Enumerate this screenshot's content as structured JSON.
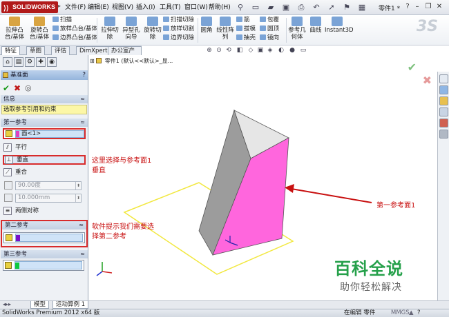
{
  "app": {
    "logo_text": "SOLIDWORKS",
    "menu": [
      "文件(F)",
      "编辑(E)",
      "视图(V)",
      "插入(I)",
      "工具(T)",
      "窗口(W)",
      "帮助(H)"
    ],
    "part_name": "零件1 *",
    "help_icon": "?"
  },
  "ribbon": {
    "big_buttons": [
      {
        "label1": "拉伸凸",
        "label2": "台/基体",
        "color": "#d9a441"
      },
      {
        "label1": "旋转凸",
        "label2": "台/基体",
        "color": "#d9a441"
      },
      {
        "label1": "拉伸切",
        "label2": "除",
        "color": "#7aa3d6"
      },
      {
        "label1": "异型孔",
        "label2": "向导",
        "color": "#7aa3d6"
      },
      {
        "label1": "旋转切",
        "label2": "除",
        "color": "#7aa3d6"
      },
      {
        "label1": "圆角",
        "label2": "",
        "color": "#7aa3d6"
      },
      {
        "label1": "线性阵",
        "label2": "列",
        "color": "#7aa3d6"
      },
      {
        "label1": "参考几",
        "label2": "何体",
        "color": "#7aa3d6"
      },
      {
        "label1": "曲线",
        "label2": "",
        "color": "#7aa3d6"
      },
      {
        "label1": "Instant3D",
        "label2": "",
        "color": "#7aa3d6"
      }
    ],
    "small_buttons": {
      "scan": "扫描",
      "loft_boss": "放样凸台/基体",
      "boundary_boss": "边界凸台/基体",
      "scan_cut": "扫描切除",
      "loft_cut": "放样切割",
      "boundary_cut": "边界切除",
      "rib": "筋",
      "draft": "拔模",
      "shell": "抽壳",
      "wrap": "包覆",
      "dome": "圆顶",
      "mirror": "镜向"
    }
  },
  "left_tabs": [
    "特征",
    "草图",
    "评估",
    "DimXpert",
    "办公室产品"
  ],
  "property_manager": {
    "title": "基准面",
    "help": "?",
    "info_header": "信息",
    "message": "选取参考引用和约束",
    "first_ref_header": "第一参考",
    "first_ref_value": "面<1>",
    "options": [
      "平行",
      "垂直",
      "重合"
    ],
    "angle_value": "90.00度",
    "distance_value": "10.000mm",
    "symmetric_label": "两侧对称",
    "second_ref_header": "第二参考",
    "third_ref_header": "第三参考",
    "first_ref_color": "#e040c0",
    "second_ref_color": "#7a10c8",
    "third_ref_color": "#10c840"
  },
  "graphics": {
    "tree_path": "零件1 (默认<<默认>_显..."
  },
  "annotations": {
    "a1_line1": "这里选择与参考面1",
    "a1_line2": "垂直",
    "a2_line1": "软件提示我们需要选",
    "a2_line2": "择第二参考",
    "a3": "第一参考面1"
  },
  "brand": {
    "title": "百科全说",
    "subtitle": "助你轻松解决"
  },
  "bottom_tabs": [
    "模型",
    "运动算例 1"
  ],
  "status": {
    "left": "SolidWorks Premium 2012 x64 版",
    "editing": "在编辑 零件",
    "units": "MMGS",
    "unit_arrow": "▲",
    "help": "?"
  },
  "colors": {
    "accent_red": "#d82b2b",
    "annotation_red": "#c81010",
    "face_magenta": "#ff66dd",
    "face_gray": "#9a9a9a",
    "plane_yellow": "#f2e840",
    "brand_green": "#25a04a"
  }
}
